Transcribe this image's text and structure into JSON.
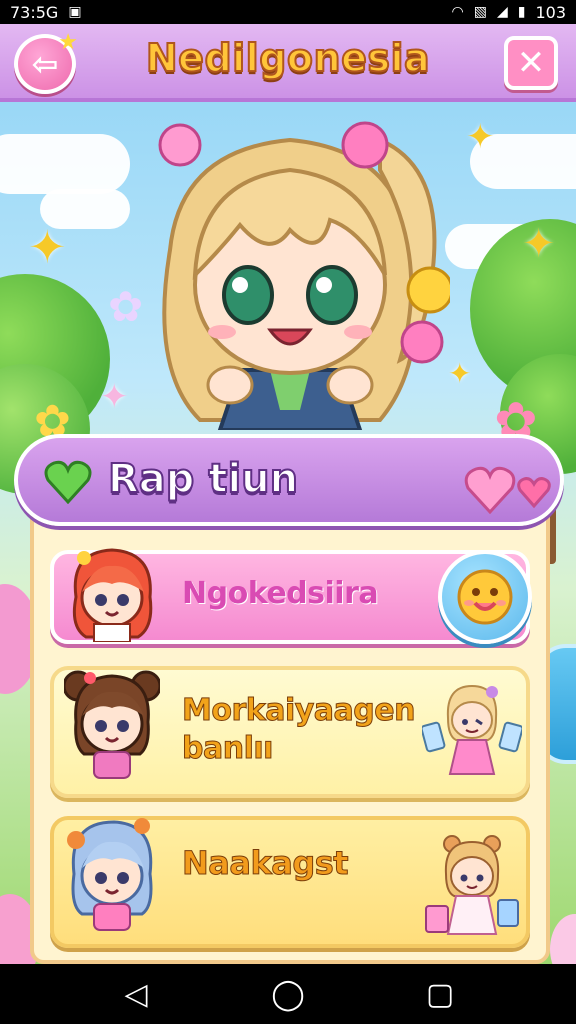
{
  "status_bar": {
    "time": "73:5G",
    "battery_text": "103",
    "icons": [
      "notification-icon",
      "wifi-icon",
      "signal-icon",
      "battery-icon"
    ]
  },
  "header": {
    "title": "Nedilgonesia",
    "back_icon": "back-arrow-icon",
    "close_icon": "close-icon"
  },
  "panel": {
    "title": "Rap tiun",
    "items": [
      {
        "label": "Ngokedsiira",
        "action_icon": "smiley-icon"
      },
      {
        "label_line1": "Morkaiyaagen",
        "label_line2": "banlıı"
      },
      {
        "label": "Naakagst"
      }
    ]
  },
  "nav_bar": {
    "back": "◁",
    "home": "◯",
    "recents": "▢"
  },
  "colors": {
    "header_bg": "#cc92e6",
    "title_fill": "#ffc53a",
    "panel_bg": "#fff4d0",
    "pink_card": "#f58ad0",
    "yellow_card": "#fff1a6"
  }
}
